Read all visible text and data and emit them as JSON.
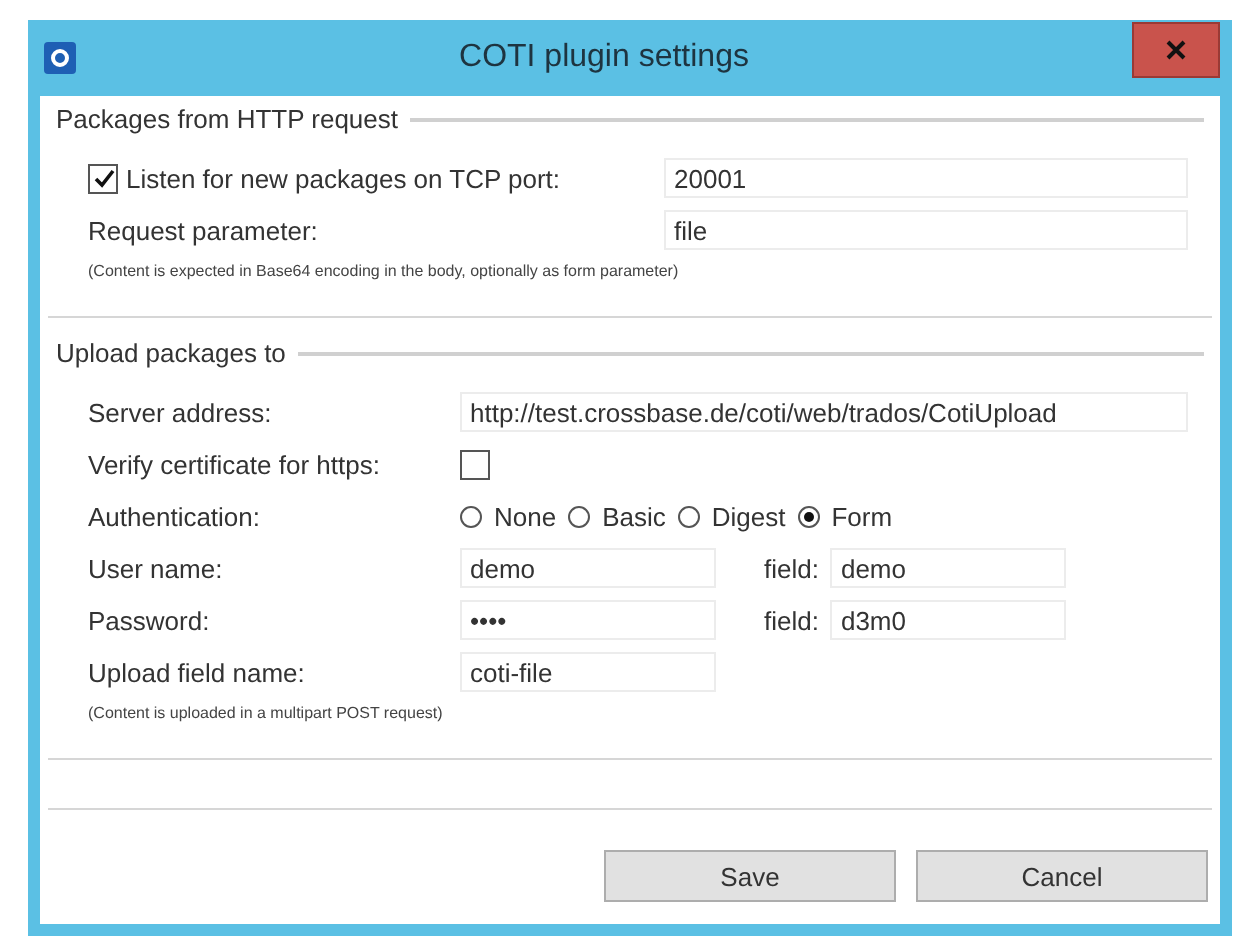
{
  "window": {
    "title": "COTI plugin settings"
  },
  "http_group": {
    "title": "Packages from HTTP request",
    "listen": {
      "label": "Listen for new packages on TCP port:",
      "checked": true,
      "value": "20001"
    },
    "request_parameter": {
      "label": "Request parameter:",
      "value": "file"
    },
    "note": "(Content is expected in Base64 encoding in the body, optionally as form parameter)"
  },
  "upload_group": {
    "title": "Upload packages to",
    "server_address": {
      "label": "Server address:",
      "value": "http://test.crossbase.de/coti/web/trados/CotiUpload"
    },
    "verify": {
      "label": "Verify certificate for https:",
      "checked": false
    },
    "authentication": {
      "label": "Authentication:",
      "options": [
        {
          "label": "None",
          "selected": false
        },
        {
          "label": "Basic",
          "selected": false
        },
        {
          "label": "Digest",
          "selected": false
        },
        {
          "label": "Form",
          "selected": true
        }
      ]
    },
    "user_name": {
      "label": "User name:",
      "value": "demo",
      "field_label": "field:",
      "field_value": "demo"
    },
    "password": {
      "label": "Password:",
      "value": "••••",
      "field_label": "field:",
      "field_value": "d3m0"
    },
    "upload_field": {
      "label": "Upload field name:",
      "value": "coti-file"
    },
    "note": "(Content is uploaded in a multipart POST request)"
  },
  "buttons": [
    "Save",
    "Cancel"
  ]
}
